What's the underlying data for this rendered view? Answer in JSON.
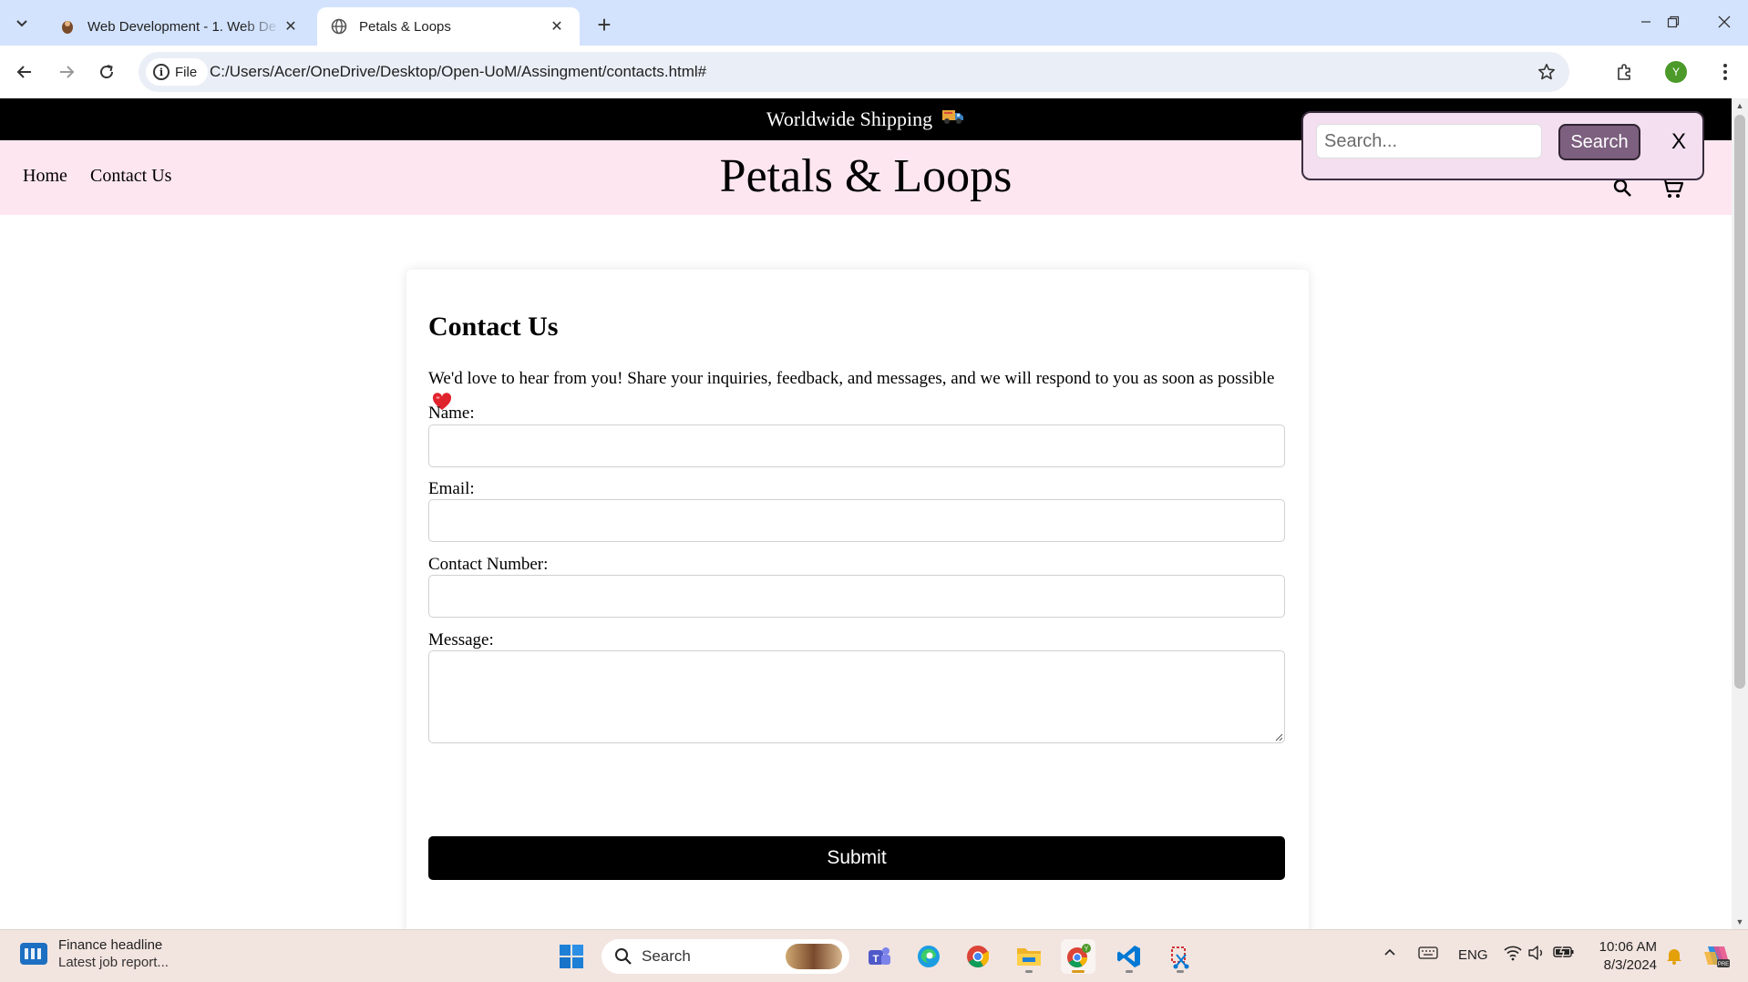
{
  "browser": {
    "tabs": [
      {
        "title": "Web Development - 1. Web De",
        "favicon": "moodle-icon",
        "active": false
      },
      {
        "title": "Petals & Loops",
        "favicon": "globe-icon",
        "active": true
      }
    ],
    "address": {
      "chip_label": "File",
      "url": "C:/Users/Acer/OneDrive/Desktop/Open-UoM/Assingment/contacts.html#"
    },
    "profile_initial": "Y"
  },
  "page": {
    "shipping_banner": {
      "text": "Worldwide Shipping",
      "icon": "delivery-truck-emoji"
    },
    "nav": {
      "home": "Home",
      "contact": "Contact Us"
    },
    "brand": "Petals & Loops",
    "search_popup": {
      "placeholder": "Search...",
      "button": "Search",
      "close": "X"
    },
    "contact": {
      "title": "Contact Us",
      "intro": "We'd love to hear from you! Share your inquiries, feedback, and messages, and we will respond to you as soon as possible",
      "fields": {
        "name_label": "Name:",
        "email_label": "Email:",
        "phone_label": "Contact Number:",
        "message_label": "Message:"
      },
      "submit": "Submit"
    }
  },
  "taskbar": {
    "news": {
      "title": "Finance headline",
      "subtitle": "Latest job report..."
    },
    "search_placeholder": "Search",
    "language": "ENG",
    "time": "10:06 AM",
    "date": "8/3/2024"
  },
  "colors": {
    "tabbar": "#d3e3fd",
    "header_pink": "#fde6ef",
    "search_button": "#7d5f7f",
    "shipping_bar": "#000000",
    "taskbar": "#f2e4df"
  }
}
